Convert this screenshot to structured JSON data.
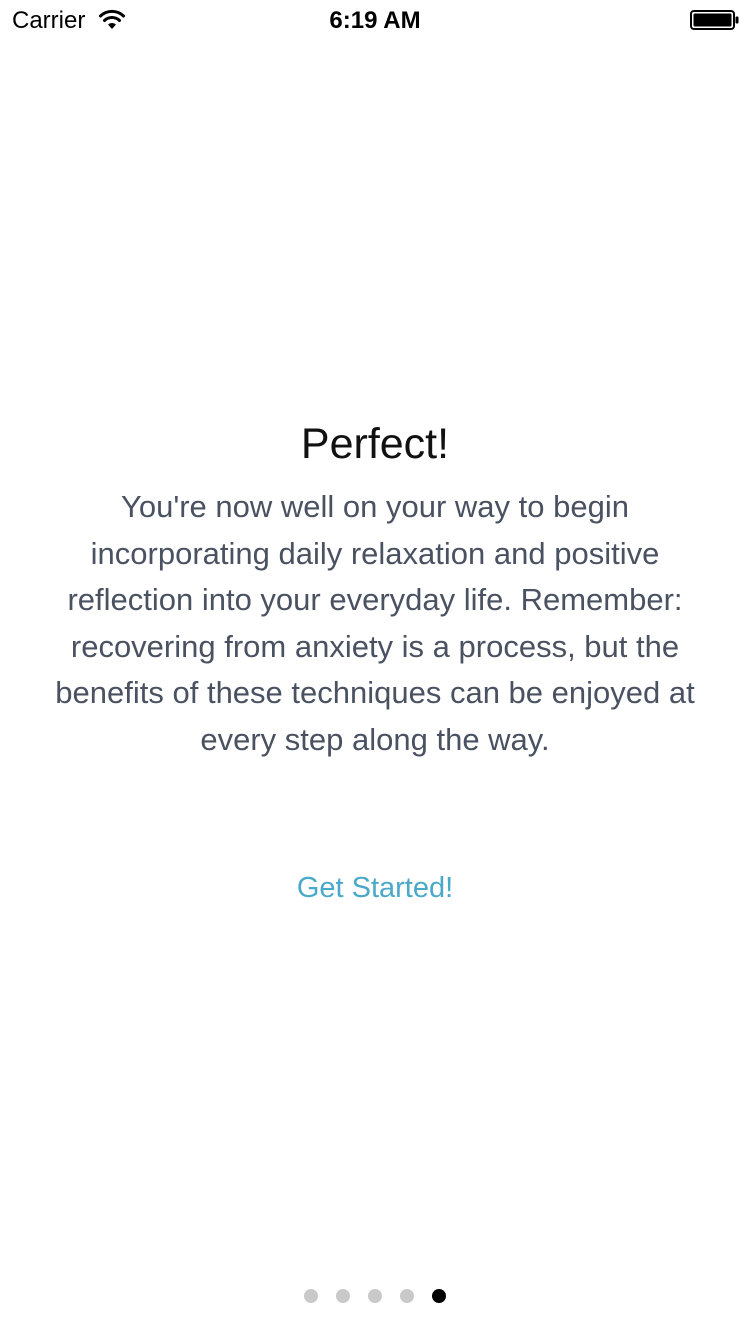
{
  "status_bar": {
    "carrier": "Carrier",
    "time": "6:19 AM",
    "wifi_icon": "wifi-icon",
    "battery_icon": "battery-full-icon"
  },
  "onboarding": {
    "title": "Perfect!",
    "body": "You're now well on your way to begin incorporating daily relaxation and positive reflection into your everyday life. Remember: recovering from anxiety is a process, but the benefits of these techniques can be enjoyed at every step along the way.",
    "cta_label": "Get Started!"
  },
  "pagination": {
    "total_pages": 5,
    "current_page": 5
  },
  "colors": {
    "body_text": "#4a5262",
    "cta": "#4aa9c9",
    "dot_inactive": "#c9c9c9",
    "dot_active": "#000000"
  }
}
